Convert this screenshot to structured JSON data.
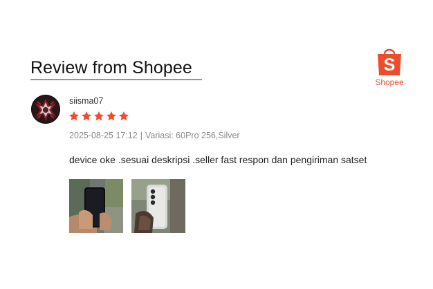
{
  "header": {
    "title": "Review from Shopee"
  },
  "brand": {
    "logo_letter": "S",
    "logo_text": "Shopee",
    "color": "#ee4d2d"
  },
  "review": {
    "username": "siisma07",
    "rating": 5,
    "rating_max": 5,
    "star_color": "#ee4d2d",
    "date": "2025-08-25 17:12",
    "separator": "|",
    "variation": "Variasi: 60Pro 256,Silver",
    "text": "device oke .sesuai deskripsi .seller fast respon dan pengiriman satset",
    "photos": [
      {
        "name": "review-photo-1"
      },
      {
        "name": "review-photo-2"
      }
    ]
  }
}
